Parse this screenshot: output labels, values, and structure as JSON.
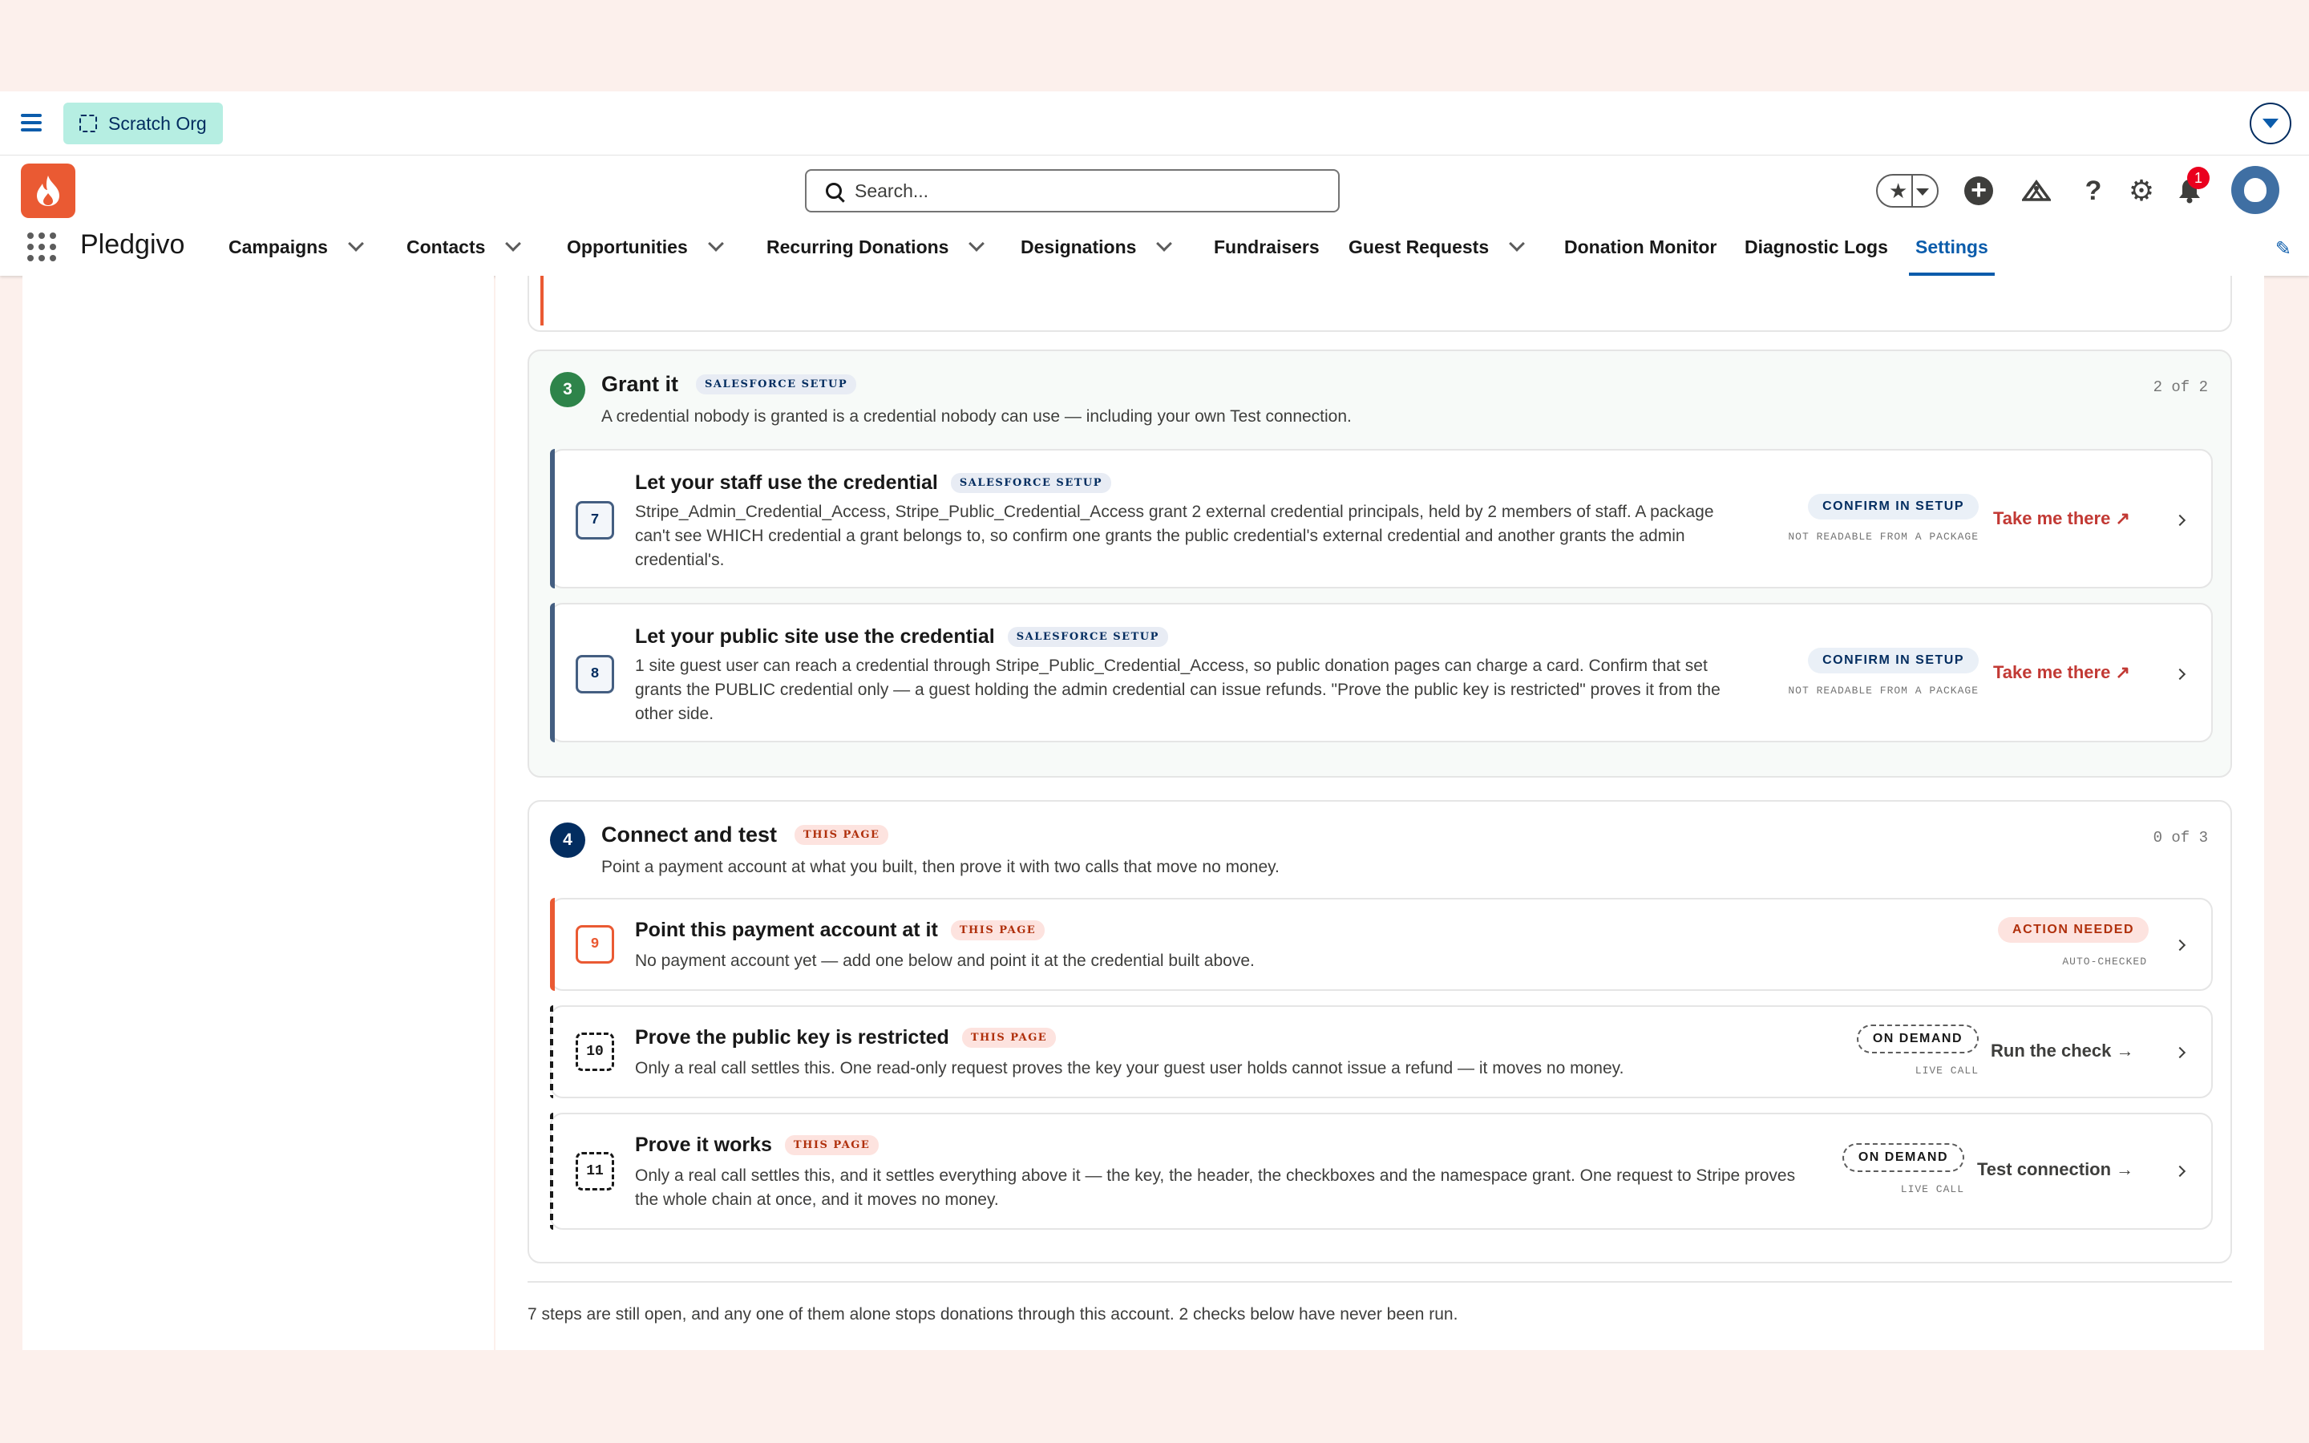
{
  "org": {
    "label": "Scratch Org"
  },
  "search": {
    "placeholder": "Search..."
  },
  "notifications": {
    "count": "1"
  },
  "app": {
    "name": "Pledgivo"
  },
  "nav": {
    "items": [
      {
        "label": "Campaigns",
        "has_dropdown": true
      },
      {
        "label": "Contacts",
        "has_dropdown": true
      },
      {
        "label": "Opportunities",
        "has_dropdown": true
      },
      {
        "label": "Recurring Donations",
        "has_dropdown": true
      },
      {
        "label": "Designations",
        "has_dropdown": true
      },
      {
        "label": "Fundraisers",
        "has_dropdown": false
      },
      {
        "label": "Guest Requests",
        "has_dropdown": true
      },
      {
        "label": "Donation Monitor",
        "has_dropdown": false
      },
      {
        "label": "Diagnostic Logs",
        "has_dropdown": false
      },
      {
        "label": "Settings",
        "has_dropdown": false,
        "active": true
      }
    ]
  },
  "colors": {
    "accent": "#0b5cab",
    "brand": "#ea5a33",
    "step3": "#2e844a",
    "step4": "#032d60"
  },
  "sections": [
    {
      "number": "3",
      "title": "Grant it",
      "tag": "SALESFORCE SETUP",
      "description": "A credential nobody is granted is a credential nobody can use — including your own Test connection.",
      "count": "2 of 2",
      "steps": [
        {
          "number": "7",
          "title": "Let your staff use the credential",
          "tag": "SALESFORCE SETUP",
          "description": "Stripe_Admin_Credential_Access, Stripe_Public_Credential_Access grant 2 external credential principals, held by 2 members of staff. A package can't see WHICH credential a grant belongs to, so confirm one grants the public credential's external credential and another grants the admin credential's.",
          "status": "CONFIRM IN SETUP",
          "status_sub": "NOT READABLE FROM A PACKAGE",
          "action": "Take me there ↗"
        },
        {
          "number": "8",
          "title": "Let your public site use the credential",
          "tag": "SALESFORCE SETUP",
          "description": "1 site guest user can reach a credential through Stripe_Public_Credential_Access, so public donation pages can charge a card. Confirm that set grants the PUBLIC credential only — a guest holding the admin credential can issue refunds. \"Prove the public key is restricted\" proves it from the other side.",
          "status": "CONFIRM IN SETUP",
          "status_sub": "NOT READABLE FROM A PACKAGE",
          "action": "Take me there ↗"
        }
      ]
    },
    {
      "number": "4",
      "title": "Connect and test",
      "tag": "THIS PAGE",
      "description": "Point a payment account at what you built, then prove it with two calls that move no money.",
      "count": "0 of 3",
      "steps": [
        {
          "number": "9",
          "title": "Point this payment account at it",
          "tag": "THIS PAGE",
          "description": "No payment account yet — add one below and point it at the credential built above.",
          "status": "ACTION NEEDED",
          "status_sub": "AUTO-CHECKED",
          "action": ""
        },
        {
          "number": "10",
          "title": "Prove the public key is restricted",
          "tag": "THIS PAGE",
          "description": "Only a real call settles this. One read-only request proves the key your guest user holds cannot issue a refund — it moves no money.",
          "status": "ON DEMAND",
          "status_sub": "LIVE CALL",
          "action": "Run the check →"
        },
        {
          "number": "11",
          "title": "Prove it works",
          "tag": "THIS PAGE",
          "description": "Only a real call settles this, and it settles everything above it — the key, the header, the checkboxes and the namespace grant. One request to Stripe proves the whole chain at once, and it moves no money.",
          "status": "ON DEMAND",
          "status_sub": "LIVE CALL",
          "action": "Test connection →"
        }
      ]
    }
  ],
  "footer": {
    "text": "7 steps are still open, and any one of them alone stops donations through this account. 2 checks below have never been run."
  }
}
